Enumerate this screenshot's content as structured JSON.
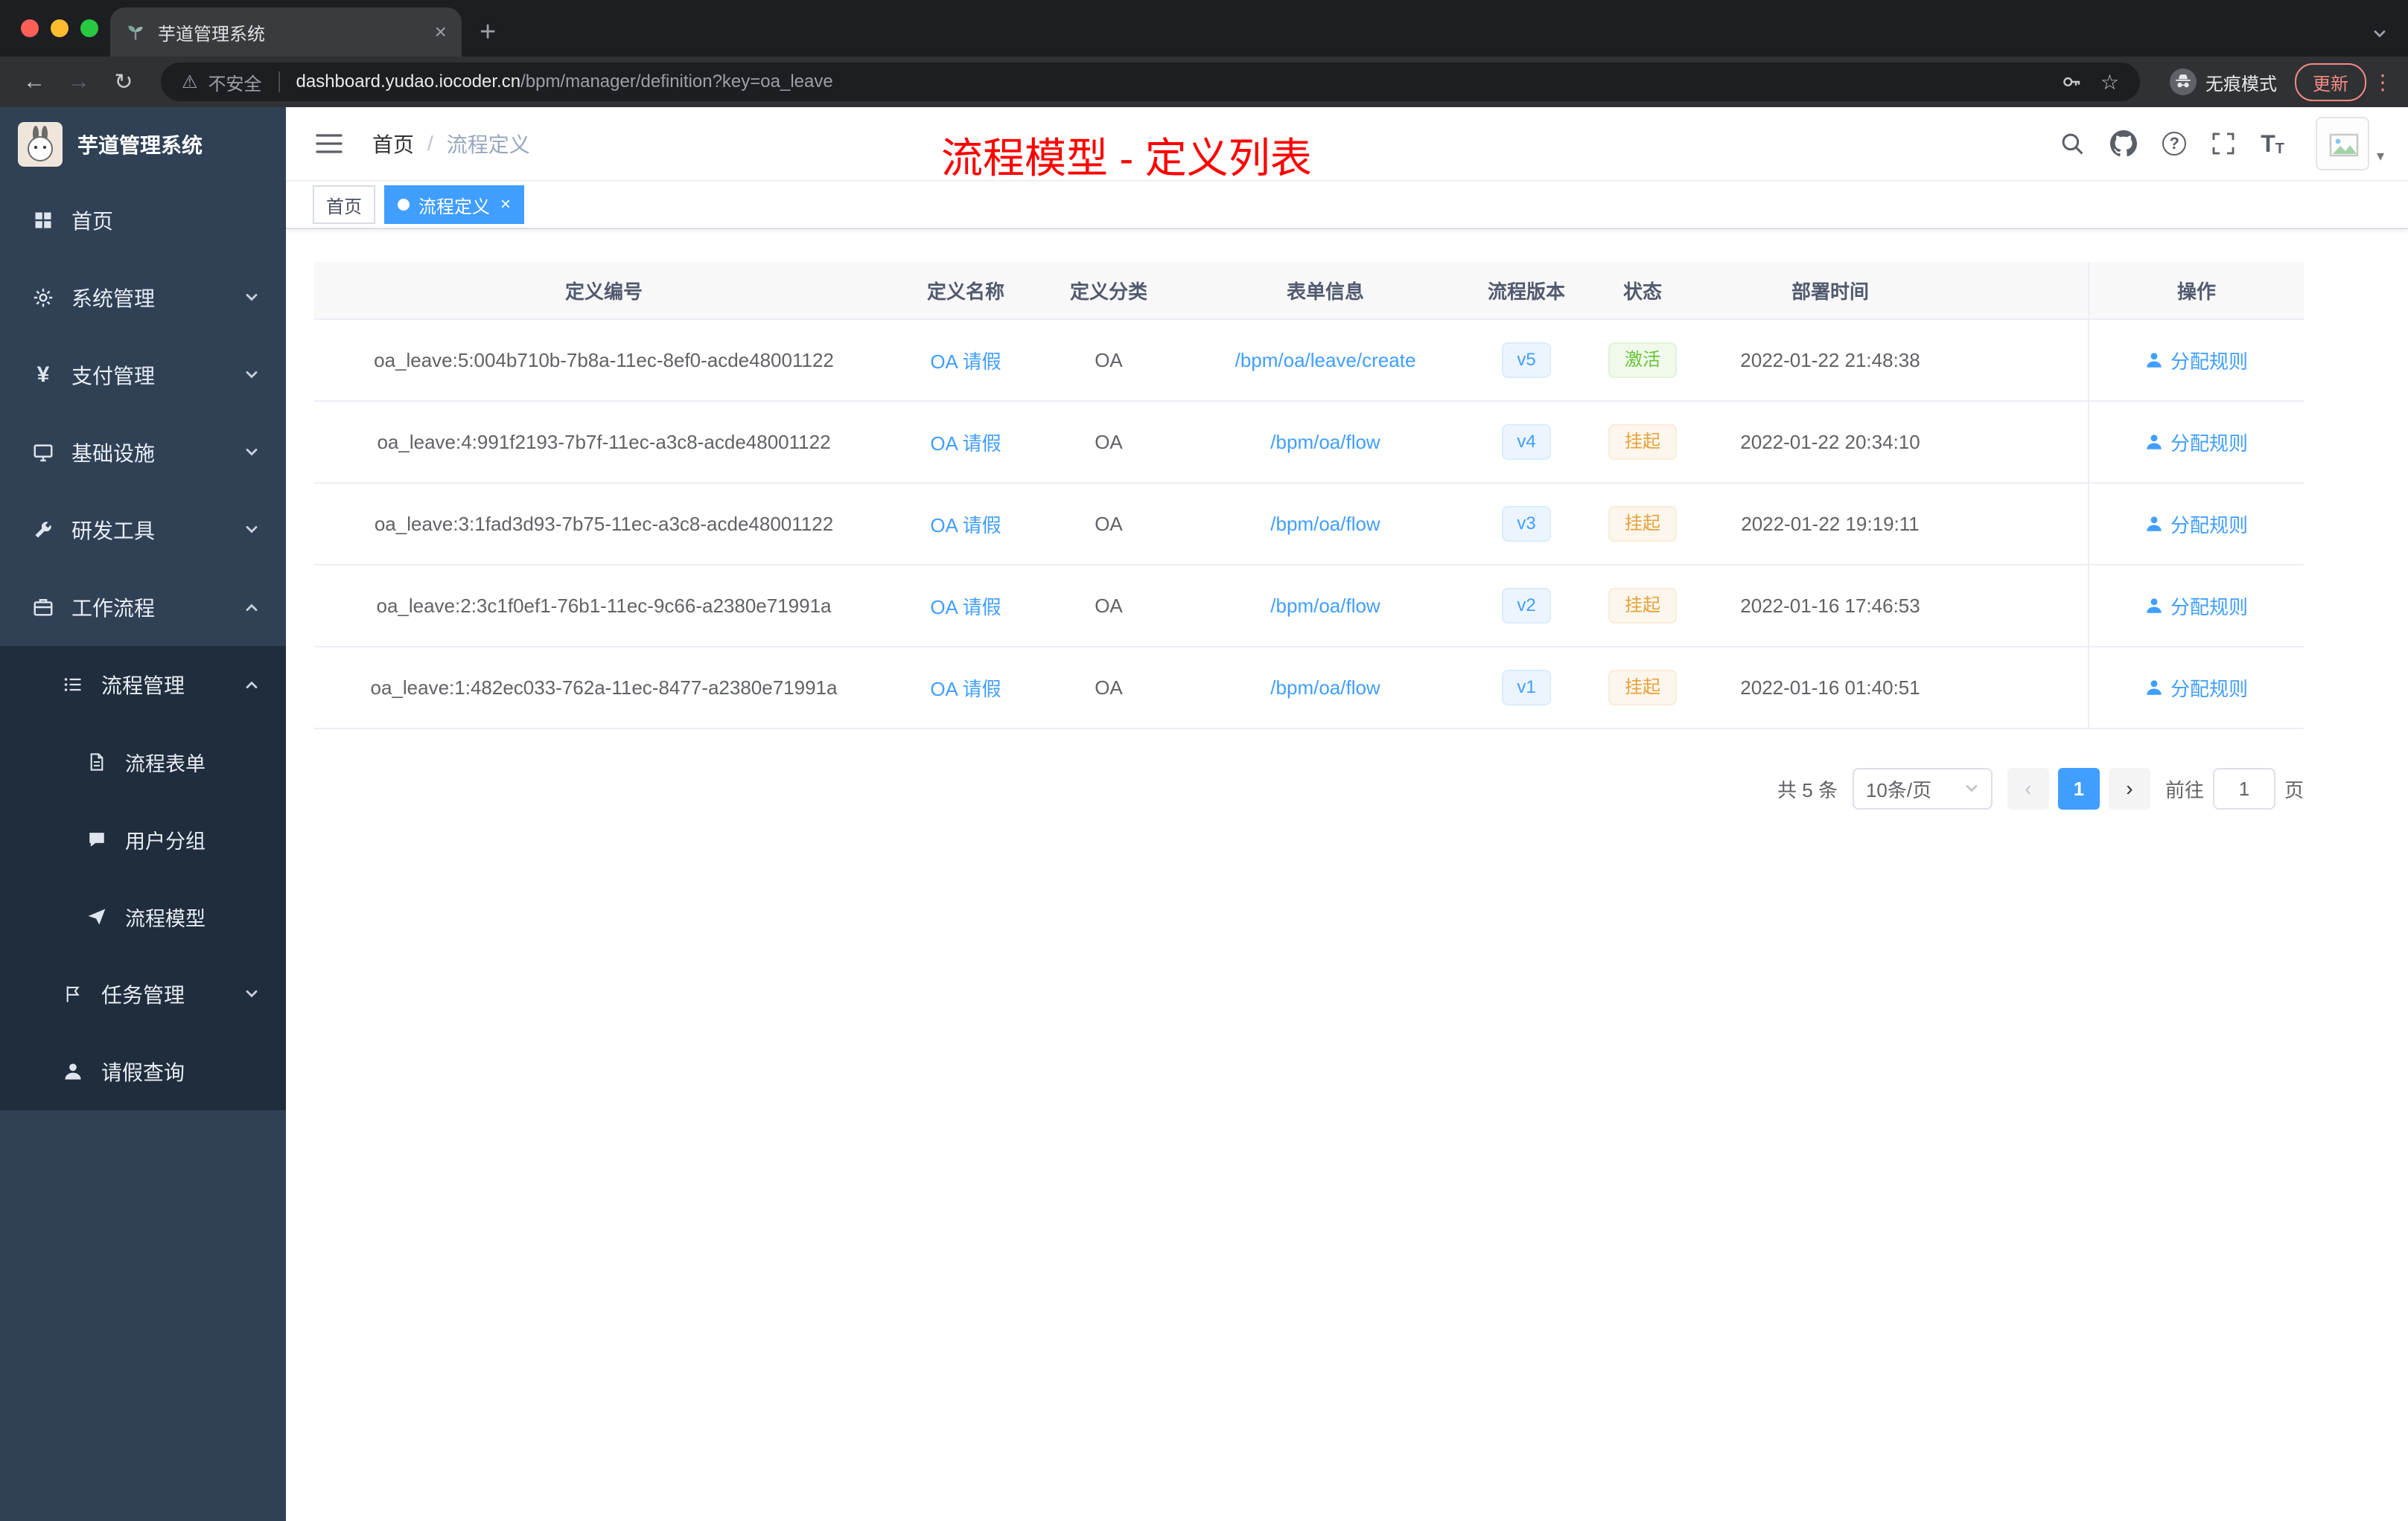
{
  "browser": {
    "tab_title": "芋道管理系统",
    "security_label": "不安全",
    "url_host": "dashboard.yudao.iocoder.cn",
    "url_path": "/bpm/manager/definition?key=oa_leave",
    "incognito_label": "无痕模式",
    "update_label": "更新"
  },
  "sidebar": {
    "logo_title": "芋道管理系统",
    "items": [
      {
        "label": "首页",
        "icon": "dashboard-icon",
        "level": 1
      },
      {
        "label": "系统管理",
        "icon": "gear-icon",
        "level": 1,
        "chevron": "down"
      },
      {
        "label": "支付管理",
        "icon": "yuan-icon",
        "level": 1,
        "chevron": "down"
      },
      {
        "label": "基础设施",
        "icon": "monitor-icon",
        "level": 1,
        "chevron": "down"
      },
      {
        "label": "研发工具",
        "icon": "wrench-icon",
        "level": 1,
        "chevron": "down"
      },
      {
        "label": "工作流程",
        "icon": "briefcase-icon",
        "level": 1,
        "chevron": "up"
      },
      {
        "label": "流程管理",
        "icon": "list-icon",
        "level": 2,
        "chevron": "up"
      },
      {
        "label": "流程表单",
        "icon": "document-icon",
        "level": 3
      },
      {
        "label": "用户分组",
        "icon": "chat-icon",
        "level": 3
      },
      {
        "label": "流程模型",
        "icon": "paper-plane-icon",
        "level": 3
      },
      {
        "label": "任务管理",
        "icon": "flag-icon",
        "level": 2,
        "chevron": "down"
      },
      {
        "label": "请假查询",
        "icon": "user-icon",
        "level": 2
      }
    ]
  },
  "header": {
    "breadcrumb": {
      "home": "首页",
      "separator": "/",
      "current": "流程定义"
    },
    "annotation": "流程模型 - 定义列表"
  },
  "tags": {
    "home": "首页",
    "active": "流程定义"
  },
  "table": {
    "columns": [
      "定义编号",
      "定义名称",
      "定义分类",
      "表单信息",
      "流程版本",
      "状态",
      "部署时间",
      "操作"
    ],
    "rows": [
      {
        "id": "oa_leave:5:004b710b-7b8a-11ec-8ef0-acde48001122",
        "name": "OA 请假",
        "category": "OA",
        "form": "/bpm/oa/leave/create",
        "version": "v5",
        "status": "激活",
        "status_type": "success",
        "deploy_time": "2022-01-22 21:48:38",
        "action": "分配规则"
      },
      {
        "id": "oa_leave:4:991f2193-7b7f-11ec-a3c8-acde48001122",
        "name": "OA 请假",
        "category": "OA",
        "form": "/bpm/oa/flow",
        "version": "v4",
        "status": "挂起",
        "status_type": "warning",
        "deploy_time": "2022-01-22 20:34:10",
        "action": "分配规则"
      },
      {
        "id": "oa_leave:3:1fad3d93-7b75-11ec-a3c8-acde48001122",
        "name": "OA 请假",
        "category": "OA",
        "form": "/bpm/oa/flow",
        "version": "v3",
        "status": "挂起",
        "status_type": "warning",
        "deploy_time": "2022-01-22 19:19:11",
        "action": "分配规则"
      },
      {
        "id": "oa_leave:2:3c1f0ef1-76b1-11ec-9c66-a2380e71991a",
        "name": "OA 请假",
        "category": "OA",
        "form": "/bpm/oa/flow",
        "version": "v2",
        "status": "挂起",
        "status_type": "warning",
        "deploy_time": "2022-01-16 17:46:53",
        "action": "分配规则"
      },
      {
        "id": "oa_leave:1:482ec033-762a-11ec-8477-a2380e71991a",
        "name": "OA 请假",
        "category": "OA",
        "form": "/bpm/oa/flow",
        "version": "v1",
        "status": "挂起",
        "status_type": "warning",
        "deploy_time": "2022-01-16 01:40:51",
        "action": "分配规则"
      }
    ]
  },
  "pagination": {
    "total": "共 5 条",
    "page_size": "10条/页",
    "current_page": "1",
    "goto_label": "前往",
    "goto_page": "1",
    "goto_unit": "页"
  },
  "colors": {
    "accent": "#409EFF",
    "success": "#67C23A",
    "warning": "#E6A23C",
    "annotation_red": "#FF0000",
    "sidebar_bg": "#304156"
  }
}
